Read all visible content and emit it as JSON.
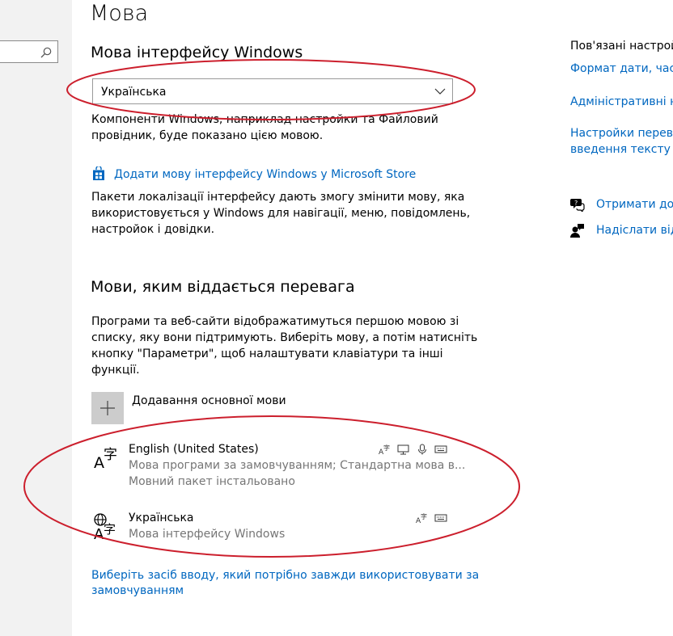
{
  "sidebar": {
    "search_placeholder": ""
  },
  "page_title": "Мова",
  "interface_language": {
    "heading": "Мова інтерфейсу Windows",
    "selected": "Українська",
    "description_lines": [
      "Компоненти Windows, наприклад настройки та Файловий",
      "провідник, буде показано цією мовою."
    ],
    "store_link": "Додати мову інтерфейсу Windows у Microsoft Store",
    "store_description_lines": [
      "Пакети локалізації інтерфейсу дають змогу змінити мову, яка",
      "використовується у Windows для навігації, меню, повідомлень,",
      "настройок і довідки."
    ]
  },
  "preferred_languages": {
    "heading": "Мови, яким віддається перевага",
    "description_lines": [
      "Програми та веб-сайти відображатимуться першою мовою зі",
      "списку, яку вони підтримують. Виберіть мову, а потім натисніть",
      "кнопку \"Параметри\", щоб налаштувати клавіатури та інші",
      "функції."
    ],
    "add_label": "Додавання основної мови",
    "languages": [
      {
        "name": "English (United States)",
        "line1": "Мова програми за замовчуванням; Стандартна мова в...",
        "line2": "Мовний пакет інстальовано",
        "features": [
          "text-to-speech-icon",
          "display-icon",
          "speech-icon",
          "keyboard-icon"
        ]
      },
      {
        "name": "Українська",
        "line1": "Мова інтерфейсу Windows",
        "features": [
          "text-to-speech-icon",
          "keyboard-icon"
        ]
      }
    ],
    "input_method_link_lines": [
      "Виберіть засіб вводу, який потрібно завжди використовувати за",
      "замовчуванням"
    ]
  },
  "related": {
    "heading": "Пов'язані настройк",
    "links": [
      [
        "Формат дати, часу"
      ],
      [
        "Адміністративні на"
      ],
      [
        "Настройки перевір",
        "введення тексту та"
      ]
    ],
    "help": [
      {
        "icon": "chat-help-icon",
        "label": "Отримати дов"
      },
      {
        "icon": "feedback-icon",
        "label": "Надіслати від"
      }
    ]
  },
  "colors": {
    "link": "#0067c0",
    "annotation": "#cc1f2d",
    "secondary_text": "#767676"
  }
}
